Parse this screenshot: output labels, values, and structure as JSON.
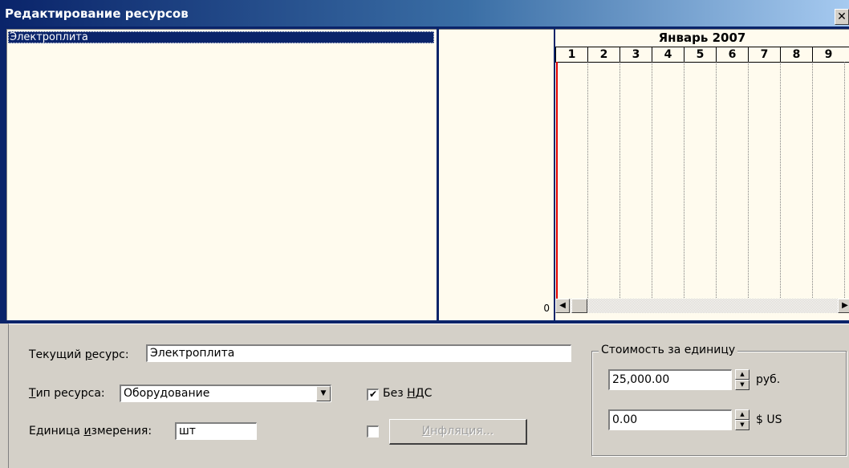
{
  "window": {
    "title": "Редактирование ресурсов",
    "close_glyph": "✕"
  },
  "resource_list": {
    "items": [
      "Электроплита"
    ]
  },
  "mid_pane": {
    "axis_value": "0"
  },
  "gantt": {
    "month": "Январь 2007",
    "days": [
      "1",
      "2",
      "3",
      "4",
      "5",
      "6",
      "7",
      "8",
      "9"
    ],
    "today_line_color": "#e00000"
  },
  "form": {
    "current_resource_label_pre": "Текущий ",
    "current_resource_label_u": "р",
    "current_resource_label_post": "есурс:",
    "current_resource_value": "Электроплита",
    "type_label_u": "Т",
    "type_label_post": "ип ресурса:",
    "type_value": "Оборудование",
    "unit_label_pre": "Единица ",
    "unit_label_u": "и",
    "unit_label_post": "змерения:",
    "unit_value": "шт",
    "no_vat_label_pre": "Без ",
    "no_vat_label_u": "Н",
    "no_vat_label_post": "ДС",
    "no_vat_checked": true,
    "inflation_checked": false,
    "inflation_button_u": "И",
    "inflation_button_post": "нфляция..."
  },
  "cost_group": {
    "title": "Стоимость за единицу",
    "rub_value": "25,000.00",
    "rub_unit": "руб.",
    "usd_value": "0.00",
    "usd_unit": "$ US"
  },
  "colors": {
    "title_bar": "#0a246a",
    "pane_bg": "#fffbee",
    "dialog_bg": "#d4d0c8"
  },
  "icons": {
    "checkmark": "✔",
    "dropdown": "▼",
    "spin_up": "▲",
    "spin_down": "▼",
    "scroll_left": "◀",
    "scroll_right": "▶"
  }
}
